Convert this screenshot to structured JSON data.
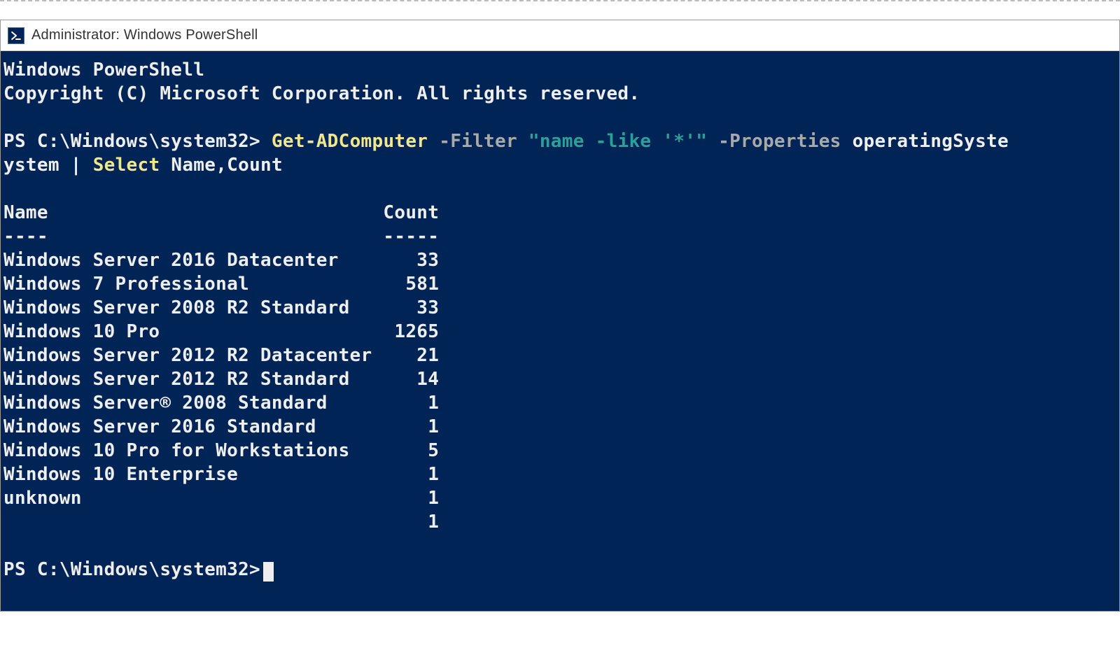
{
  "window": {
    "title": "Administrator: Windows PowerShell"
  },
  "banner": {
    "line1": "Windows PowerShell",
    "line2": "Copyright (C) Microsoft Corporation. All rights reserved."
  },
  "prompt1": {
    "ps": "PS C:\\Windows\\system32>",
    "cmd_cmdlet": "Get-ADComputer",
    "cmd_param_filter_name": "-Filter",
    "cmd_param_filter_value": "\"name -like '*'\"",
    "cmd_param_properties_name": "-Properties",
    "cmd_param_properties_value": "operatingSyste",
    "line2_prefix": "ystem",
    "line2_pipe": "|",
    "line2_select": "Select",
    "line2_fields": "Name,Count"
  },
  "table": {
    "header_name": "Name",
    "header_count": "Count",
    "rule_name": "----",
    "rule_count": "-----",
    "rows": [
      {
        "name": "Windows Server 2016 Datacenter",
        "count": "33"
      },
      {
        "name": "Windows 7 Professional",
        "count": "581"
      },
      {
        "name": "Windows Server 2008 R2 Standard",
        "count": "33"
      },
      {
        "name": "Windows 10 Pro",
        "count": "1265"
      },
      {
        "name": "Windows Server 2012 R2 Datacenter",
        "count": "21"
      },
      {
        "name": "Windows Server 2012 R2 Standard",
        "count": "14"
      },
      {
        "name": "Windows Server® 2008 Standard",
        "count": "1"
      },
      {
        "name": "Windows Server 2016 Standard",
        "count": "1"
      },
      {
        "name": "Windows 10 Pro for Workstations",
        "count": "5"
      },
      {
        "name": "Windows 10 Enterprise",
        "count": "1"
      },
      {
        "name": "unknown",
        "count": "1"
      },
      {
        "name": "",
        "count": "1"
      }
    ]
  },
  "prompt2": {
    "ps": "PS C:\\Windows\\system32>"
  },
  "colors": {
    "terminal_bg": "#012456",
    "text": "#eeeeee",
    "cmdlet": "#f0e68c",
    "param_name": "#a9a9a9",
    "param_value": "#2aa198"
  }
}
